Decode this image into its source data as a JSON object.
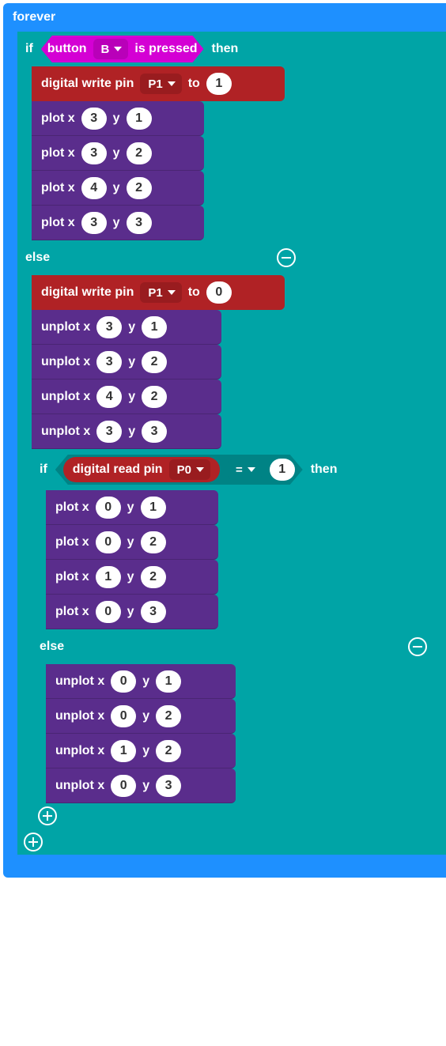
{
  "forever": {
    "label": "forever"
  },
  "if1": {
    "if": "if",
    "then": "then",
    "else": "else",
    "cond": {
      "prefix": "button",
      "value": "B",
      "suffix": "is pressed"
    }
  },
  "pins_write_then": {
    "label": "digital write pin",
    "pin": "P1",
    "to": "to",
    "value": "1"
  },
  "plot_then": [
    {
      "label": "plot x",
      "x": "3",
      "ylabel": "y",
      "y": "1"
    },
    {
      "label": "plot x",
      "x": "3",
      "ylabel": "y",
      "y": "2"
    },
    {
      "label": "plot x",
      "x": "4",
      "ylabel": "y",
      "y": "2"
    },
    {
      "label": "plot x",
      "x": "3",
      "ylabel": "y",
      "y": "3"
    }
  ],
  "pins_write_else": {
    "label": "digital write pin",
    "pin": "P1",
    "to": "to",
    "value": "0"
  },
  "unplot_else": [
    {
      "label": "unplot x",
      "x": "3",
      "ylabel": "y",
      "y": "1"
    },
    {
      "label": "unplot x",
      "x": "3",
      "ylabel": "y",
      "y": "2"
    },
    {
      "label": "unplot x",
      "x": "4",
      "ylabel": "y",
      "y": "2"
    },
    {
      "label": "unplot x",
      "x": "3",
      "ylabel": "y",
      "y": "3"
    }
  ],
  "if2": {
    "if": "if",
    "then": "then",
    "else": "else",
    "read": {
      "label": "digital read pin",
      "pin": "P0"
    },
    "op": "=",
    "rhs": "1"
  },
  "plot_if2": [
    {
      "label": "plot x",
      "x": "0",
      "ylabel": "y",
      "y": "1"
    },
    {
      "label": "plot x",
      "x": "0",
      "ylabel": "y",
      "y": "2"
    },
    {
      "label": "plot x",
      "x": "1",
      "ylabel": "y",
      "y": "2"
    },
    {
      "label": "plot x",
      "x": "0",
      "ylabel": "y",
      "y": "3"
    }
  ],
  "unplot_if2": [
    {
      "label": "unplot x",
      "x": "0",
      "ylabel": "y",
      "y": "1"
    },
    {
      "label": "unplot x",
      "x": "0",
      "ylabel": "y",
      "y": "2"
    },
    {
      "label": "unplot x",
      "x": "1",
      "ylabel": "y",
      "y": "2"
    },
    {
      "label": "unplot x",
      "x": "0",
      "ylabel": "y",
      "y": "3"
    }
  ]
}
